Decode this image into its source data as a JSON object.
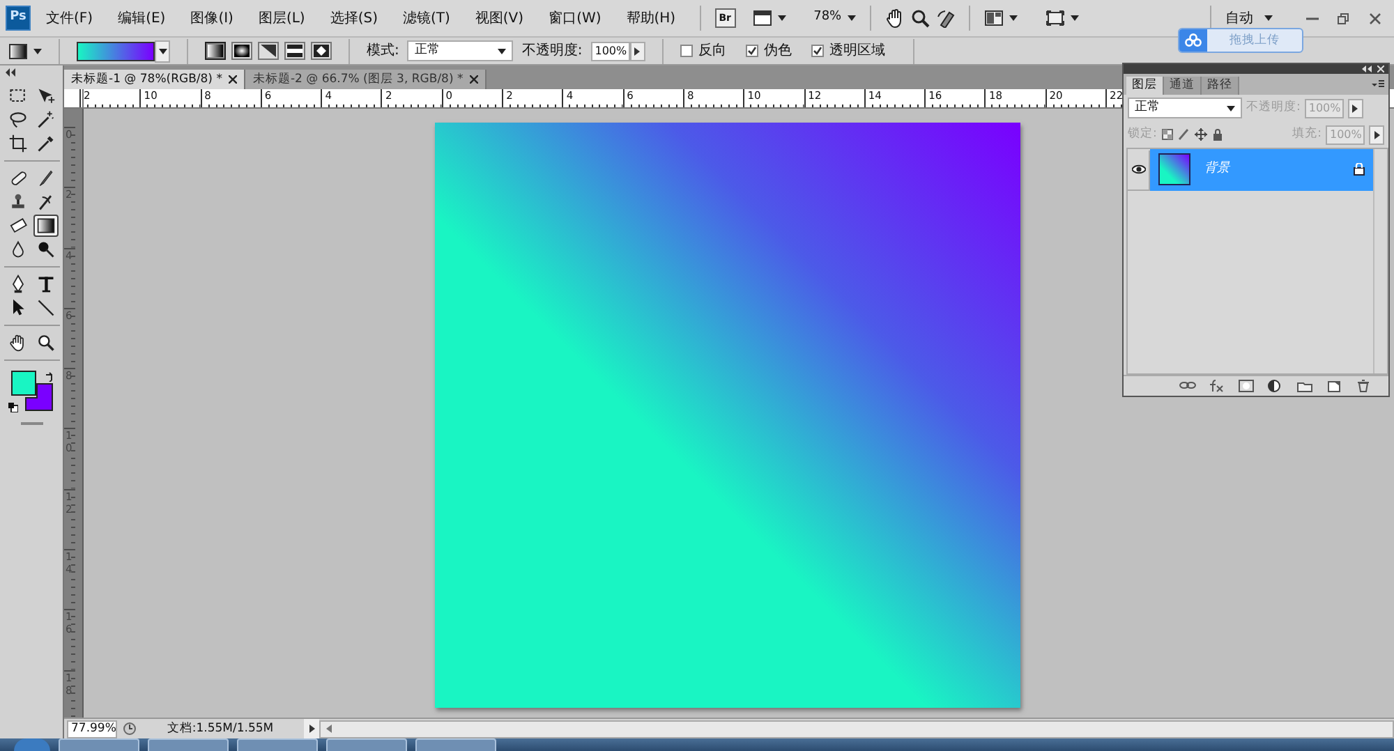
{
  "app": {
    "logo": "Ps",
    "bridge": "Br",
    "zoom": "78%",
    "workspace": "自动"
  },
  "menu": [
    {
      "label": "文件(F)"
    },
    {
      "label": "编辑(E)"
    },
    {
      "label": "图像(I)"
    },
    {
      "label": "图层(L)"
    },
    {
      "label": "选择(S)"
    },
    {
      "label": "滤镜(T)"
    },
    {
      "label": "视图(V)"
    },
    {
      "label": "窗口(W)"
    },
    {
      "label": "帮助(H)"
    }
  ],
  "upload_overlay": {
    "label": "拖拽上传"
  },
  "options_bar": {
    "gradient_types": [
      {
        "kind": "linear",
        "selected": true
      },
      {
        "kind": "radial",
        "selected": false
      },
      {
        "kind": "angle",
        "selected": false
      },
      {
        "kind": "reflected",
        "selected": false
      },
      {
        "kind": "diamond",
        "selected": false
      }
    ],
    "mode_label": "模式:",
    "mode": "正常",
    "opacity_label": "不透明度:",
    "opacity": "100%",
    "checkboxes": [
      {
        "label": "反向",
        "checked": false
      },
      {
        "label": "伪色",
        "checked": true
      },
      {
        "label": "透明区域",
        "checked": true
      }
    ]
  },
  "tools": [
    {
      "kind": "marquee",
      "selected": false
    },
    {
      "kind": "move",
      "selected": false
    },
    {
      "kind": "lasso",
      "selected": false
    },
    {
      "kind": "wand",
      "selected": false
    },
    {
      "kind": "crop",
      "selected": false
    },
    {
      "kind": "eyedropper",
      "selected": false
    },
    {
      "kind": "healing",
      "selected": false
    },
    {
      "kind": "brush",
      "selected": false
    },
    {
      "kind": "stamp",
      "selected": false
    },
    {
      "kind": "history",
      "selected": false
    },
    {
      "kind": "eraser",
      "selected": false
    },
    {
      "kind": "gradient",
      "selected": true
    },
    {
      "kind": "blur",
      "selected": false
    },
    {
      "kind": "burn",
      "selected": false
    },
    {
      "kind": "pen",
      "selected": false
    },
    {
      "kind": "type",
      "selected": false
    },
    {
      "kind": "path",
      "selected": false
    },
    {
      "kind": "line",
      "selected": false
    },
    {
      "kind": "hand",
      "selected": false
    },
    {
      "kind": "zoom",
      "selected": false
    }
  ],
  "colors": {
    "foreground": {
      "color": "#19f5c3"
    },
    "background": {
      "color": "#7a00ff"
    }
  },
  "documents": [
    {
      "title": "未标题-1 @ 78%(RGB/8) *",
      "selected": true
    },
    {
      "title": "未标题-2 @ 66.7% (图层 3, RGB/8) *",
      "selected": false
    }
  ],
  "ruler": {
    "horizontal": [
      "2",
      "10",
      "8",
      "6",
      "4",
      "2",
      "0",
      "2",
      "4",
      "6",
      "8",
      "10",
      "12",
      "14",
      "16",
      "18",
      "20",
      "22"
    ],
    "vertical": [
      "0",
      "2",
      "4",
      "6",
      "8",
      "10",
      "12",
      "14",
      "16",
      "18"
    ]
  },
  "status_bar": {
    "zoom": "77.99%",
    "doc_info": "文档:1.55M/1.55M"
  },
  "layers_panel": {
    "tabs": [
      {
        "label": "图层",
        "selected": true
      },
      {
        "label": "通道",
        "selected": false
      },
      {
        "label": "路径",
        "selected": false
      }
    ],
    "blend_mode": "正常",
    "opacity_label": "不透明度:",
    "opacity": "100%",
    "lock_label": "锁定:",
    "fill_label": "填充:",
    "fill": "100%",
    "disabled": true,
    "layers": [
      {
        "name": "背景",
        "selected": true,
        "visible": true,
        "locked": true
      }
    ]
  }
}
